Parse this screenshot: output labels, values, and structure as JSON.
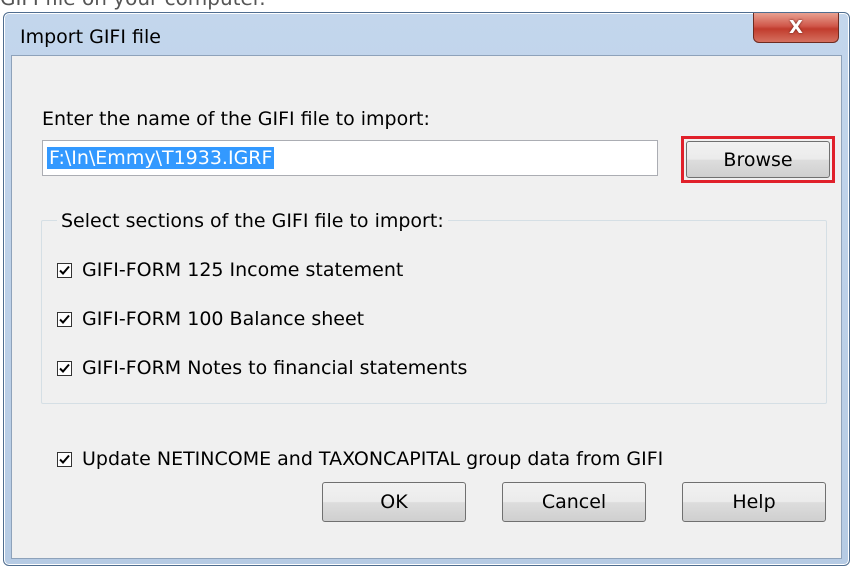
{
  "page": {
    "caption_fragment": "GIFI file on your computer."
  },
  "window": {
    "title": "Import GIFI file",
    "close_symbol": "X"
  },
  "file": {
    "label": "Enter the name of the GIFI file to import:",
    "path_value": "F:\\In\\Emmy\\T1933.IGRF",
    "browse_label": "Browse"
  },
  "sections": {
    "legend": "Select sections of the GIFI file to import:",
    "items": [
      {
        "label": "GIFI-FORM  125 Income statement",
        "checked": true
      },
      {
        "label": "GIFI-FORM  100 Balance sheet",
        "checked": true
      },
      {
        "label": "GIFI-FORM  Notes to financial statements",
        "checked": true
      }
    ]
  },
  "update_option": {
    "label": "Update NETINCOME and TAXONCAPITAL group data from GIFI",
    "checked": true
  },
  "buttons": {
    "ok": "OK",
    "cancel": "Cancel",
    "help": "Help"
  },
  "colors": {
    "highlight_border": "#e0202a",
    "selection_bg": "#3399ff",
    "close_button": "#c13c2d",
    "title_bar": "#b6cbe4"
  }
}
